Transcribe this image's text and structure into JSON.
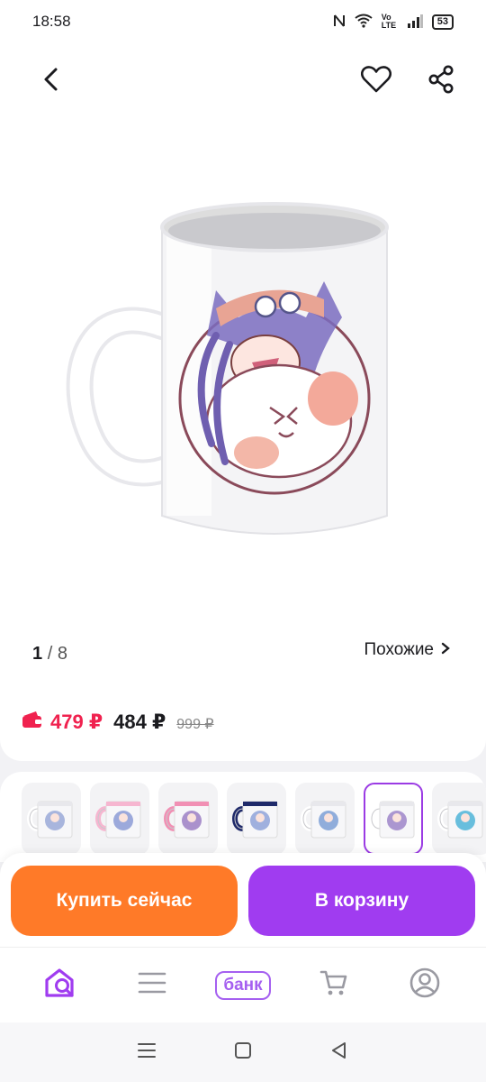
{
  "status_bar": {
    "time": "18:58",
    "network": "Vo LTE",
    "battery": "53"
  },
  "gallery": {
    "current": "1",
    "total": "8",
    "similar_label": "Похожие"
  },
  "prices": {
    "wallet_price": "479 ₽",
    "price": "484 ₽",
    "old_price": "999 ₽"
  },
  "thumbnails": [
    {
      "variant": "white",
      "selected": false
    },
    {
      "variant": "pink",
      "selected": false
    },
    {
      "variant": "pink-cat",
      "selected": false
    },
    {
      "variant": "navy",
      "selected": false
    },
    {
      "variant": "white-girl",
      "selected": false
    },
    {
      "variant": "white-cat",
      "selected": true
    },
    {
      "variant": "white-blue",
      "selected": false
    }
  ],
  "actions": {
    "buy_now": "Купить сейчас",
    "add_to_cart": "В корзину"
  },
  "bottom_nav": {
    "bank_label": "банк"
  },
  "colors": {
    "accent": "#a03cf0",
    "buy": "#ff7a28",
    "wallet": "#f0224f"
  }
}
